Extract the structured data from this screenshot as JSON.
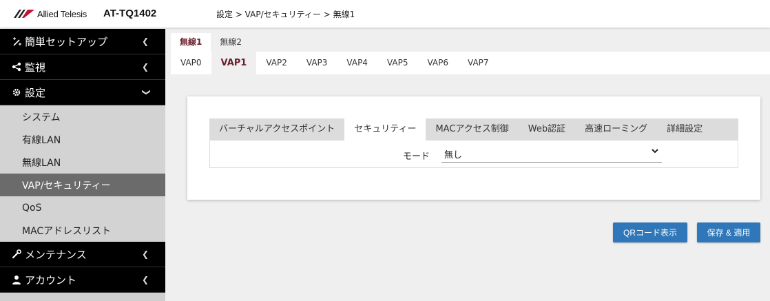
{
  "header": {
    "logo_text": "Allied Telesis",
    "model": "AT-TQ1402",
    "breadcrumb": "設定 > VAP/セキュリティー > 無線1"
  },
  "sidebar": {
    "items": [
      {
        "label": "簡単セットアップ",
        "icon": "magic-wand-icon"
      },
      {
        "label": "監視",
        "icon": "share-icon"
      },
      {
        "label": "設定",
        "icon": "gear-icon"
      }
    ],
    "sub_items": [
      "システム",
      "有線LAN",
      "無線LAN",
      "VAP/セキュリティー",
      "QoS",
      "MACアドレスリスト"
    ],
    "active_sub": "VAP/セキュリティー",
    "bottom_items": [
      {
        "label": "メンテナンス",
        "icon": "wrench-icon"
      },
      {
        "label": "アカウント",
        "icon": "user-icon"
      }
    ]
  },
  "radio_tabs": [
    "無線1",
    "無線2"
  ],
  "active_radio": "無線1",
  "vap_tabs": [
    "VAP0",
    "VAP1",
    "VAP2",
    "VAP3",
    "VAP4",
    "VAP5",
    "VAP6",
    "VAP7"
  ],
  "active_vap": "VAP1",
  "inner_tabs": [
    "バーチャルアクセスポイント",
    "セキュリティー",
    "MACアクセス制御",
    "Web認証",
    "高速ローミング",
    "詳細設定"
  ],
  "active_inner": "セキュリティー",
  "form": {
    "mode_label": "モード",
    "mode_value": "無し"
  },
  "buttons": {
    "qr": "QRコード表示",
    "save": "保存 & 適用"
  },
  "colors": {
    "accent_tab": "#6a1f2a",
    "button": "#2f77b8",
    "sidebar_dark": "#000000",
    "sidebar_active": "#6b6b6b"
  }
}
